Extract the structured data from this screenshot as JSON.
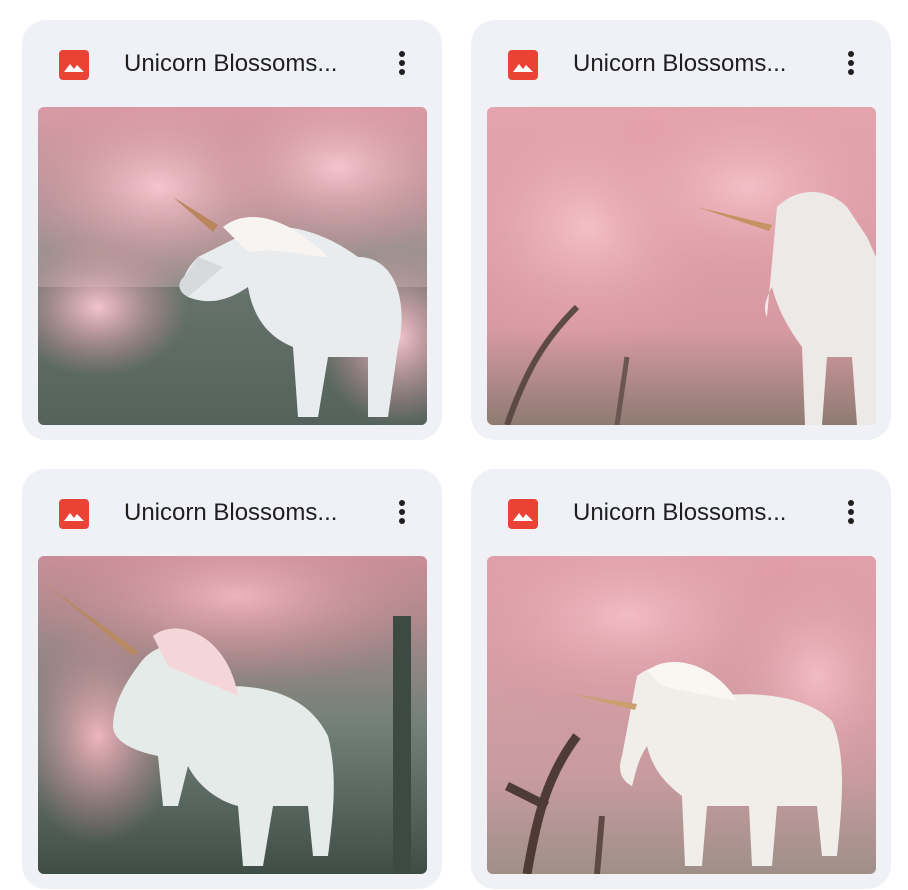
{
  "files": [
    {
      "title": "Unicorn Blossoms...",
      "icon": "image-file-icon",
      "menu_icon": "more-vert-icon",
      "thumbnail_alt": "White unicorn under pink cherry blossom tree"
    },
    {
      "title": "Unicorn Blossoms...",
      "icon": "image-file-icon",
      "menu_icon": "more-vert-icon",
      "thumbnail_alt": "White unicorn among pink cherry blossom trees"
    },
    {
      "title": "Unicorn Blossoms...",
      "icon": "image-file-icon",
      "menu_icon": "more-vert-icon",
      "thumbnail_alt": "White unicorn walking under pink blossoms"
    },
    {
      "title": "Unicorn Blossoms...",
      "icon": "image-file-icon",
      "menu_icon": "more-vert-icon",
      "thumbnail_alt": "White unicorn standing beneath cherry blossom tree"
    }
  ],
  "colors": {
    "card_bg": "#eff1f6",
    "icon_red": "#ea4335",
    "text": "#1f1f1f",
    "blossom": "#e8a9b1"
  }
}
